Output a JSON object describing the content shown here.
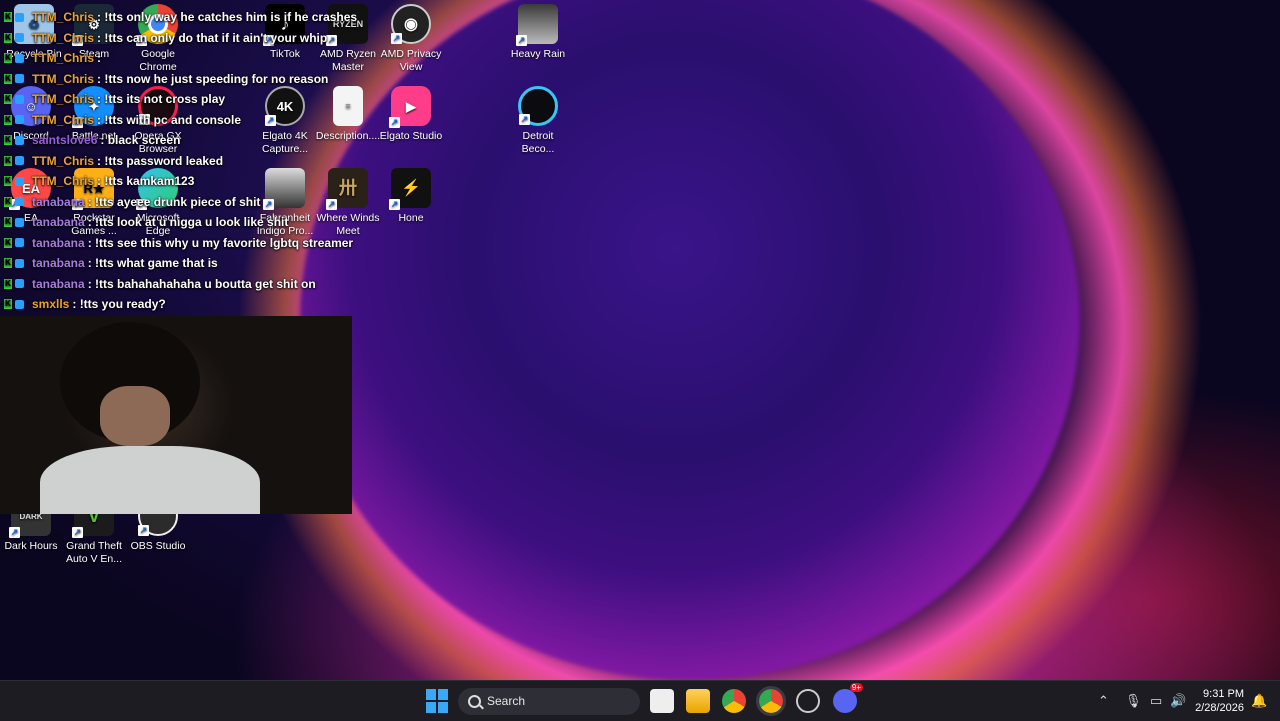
{
  "desktop_icons": {
    "recycle_bin": "Recycle Bin",
    "steam": "Steam",
    "google_chrome": "Google\nChrome",
    "tiktok": "TikTok",
    "amd_ryzen_master": "AMD Ryzen\nMaster",
    "amd_privacy_view": "AMD Privacy\nView",
    "heavy_rain": "Heavy Rain",
    "discord": "Discord",
    "battle_net": "Battle.net",
    "opera_gx": "Opera GX\nBrowser",
    "elgato_4k": "Elgato 4K\nCapture...",
    "description": "Description....",
    "elgato_studio": "Elgato Studio",
    "detroit": "Detroit\nBeco...",
    "ea": "EA",
    "rockstar": "Rockstar\nGames ...",
    "microsoft_edge": "Microsoft\nEdge",
    "fahrenheit": "Fahrenheit\nIndigo Pro...",
    "where_winds_meet": "Where Winds\nMeet",
    "hone": "Hone",
    "dark_hours": "Dark Hours",
    "gta5": "Grand Theft\nAuto V En...",
    "obs_studio": "OBS Studio"
  },
  "chat": [
    {
      "user": "TTM_Chris",
      "color": "#e8a23a",
      "msg": ": !tts only way he catches him is if he crashes"
    },
    {
      "user": "TTM_Chris",
      "color": "#e8a23a",
      "msg": ": !tts can only do that if it ain't your whip"
    },
    {
      "user": "TTM_Chris",
      "color": "#e8a23a",
      "msg": ":"
    },
    {
      "user": "TTM_Chris",
      "color": "#e8a23a",
      "msg": ": !tts now he just speeding for no reason"
    },
    {
      "user": "TTM_Chris",
      "color": "#e8a23a",
      "msg": ": !tts its not cross play"
    },
    {
      "user": "TTM_Chris",
      "color": "#e8a23a",
      "msg": ": !tts with pc and console"
    },
    {
      "user": "saintslove6",
      "color": "#9b5de5",
      "msg": ": black screen"
    },
    {
      "user": "TTM_Chris",
      "color": "#e8a23a",
      "msg": ": !tts password leaked"
    },
    {
      "user": "TTM_Chris",
      "color": "#e8a23a",
      "msg": ": !tts kamkam123"
    },
    {
      "user": "tanabana",
      "color": "#a77be0",
      "msg": ": !tts ayeee drunk piece of shit"
    },
    {
      "user": "tanabana",
      "color": "#a77be0",
      "msg": ": !tts look at u nigga u look like shit"
    },
    {
      "user": "tanabana",
      "color": "#a77be0",
      "msg": ": !tts see this why u my favorite lgbtq streamer"
    },
    {
      "user": "tanabana",
      "color": "#a77be0",
      "msg": ": !tts what game that is"
    },
    {
      "user": "tanabana",
      "color": "#a77be0",
      "msg": ": !tts bahahahahaha u boutta get shit on"
    },
    {
      "user": "smxlls",
      "color": "#f0a020",
      "msg": ": !tts you ready?"
    }
  ],
  "taskbar": {
    "search_placeholder": "Search",
    "time": "9:31 PM",
    "date": "2/28/2026",
    "discord_badge": "9+"
  }
}
